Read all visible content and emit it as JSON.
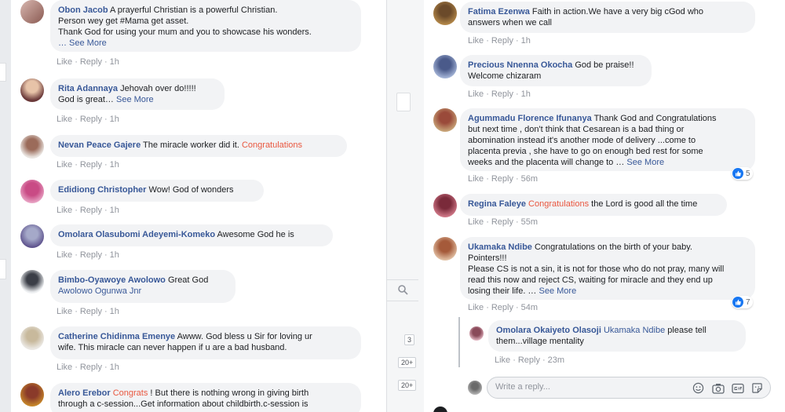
{
  "left_comments": [
    {
      "name": "Obon Jacob",
      "lines": [
        "A prayerful Christian is a powerful Christian.",
        "Person wey get #Mama get asset.",
        "Thank God for using your mum and you to showcase his wonders.",
        "… See More"
      ],
      "like": "Like",
      "reply": "Reply",
      "time": "1h"
    },
    {
      "name": "Rita Adannaya",
      "lines": [
        "Jehovah over do!!!!!",
        "God is great…"
      ],
      "see_more": "See More",
      "like": "Like",
      "reply": "Reply",
      "time": "1h"
    },
    {
      "name": "Nevan Peace Gajere",
      "text": "The miracle worker did it.",
      "highlight": "Congratulations",
      "like": "Like",
      "reply": "Reply",
      "time": "1h"
    },
    {
      "name": "Edidiong Christopher",
      "text": "Wow! God of wonders",
      "like": "Like",
      "reply": "Reply",
      "time": "1h"
    },
    {
      "name": "Omolara Olasubomi Adeyemi-Komeko",
      "text": "Awesome God he is",
      "like": "Like",
      "reply": "Reply",
      "time": "1h"
    },
    {
      "name": "Bimbo-Oyawoye Awolowo",
      "text": "Great God",
      "line2": "Awolowo Ogunwa Jnr",
      "like": "Like",
      "reply": "Reply",
      "time": "1h"
    },
    {
      "name": "Catherine Chidinma Emenye",
      "text": "Awww. God bless u Sir for loving ur",
      "line2": "wife. This miracle can never happen if u are a bad husband.",
      "like": "Like",
      "reply": "Reply",
      "time": "1h"
    },
    {
      "name": "Alero Erebor",
      "highlight": "Congrats",
      "text": "! But there is nothing wrong in giving birth",
      "line2": "through a c-session...Get information about childbirth.c-session is"
    }
  ],
  "right_comments": [
    {
      "name": "Fatima Ezenwa",
      "text": "Faith in action.We have a very big cGod who",
      "line2": "answers when we call",
      "like": "Like",
      "reply": "Reply",
      "time": "1h"
    },
    {
      "name": "Precious Nnenna Okocha",
      "text": "God be praise!!",
      "line2": "Welcome chizaram",
      "like": "Like",
      "reply": "Reply",
      "time": "1h"
    },
    {
      "name": "Agummadu Florence Ifunanya",
      "text": "Thank God and Congratulations",
      "lines": [
        "but next time , don't think that Cesarean is a bad thing or",
        "abomination instead it's another mode of delivery ...come to",
        "placenta previa , she have to go on enough bed rest for some",
        "weeks and the placenta will change to …"
      ],
      "see_more": "See More",
      "reactions": "5",
      "like": "Like",
      "reply": "Reply",
      "time": "56m"
    },
    {
      "name": "Regina Faleye",
      "highlight": "Congratulations",
      "text": "the Lord is good all the time",
      "like": "Like",
      "reply": "Reply",
      "time": "55m"
    },
    {
      "name": "Ukamaka Ndibe",
      "text": "Congratulations on the birth of your baby.",
      "lines": [
        "Pointers!!!",
        "Please CS is not a sin, it is not for those who do not pray, many will",
        "read this now and reject CS, waiting for miracle and they end up",
        "losing their life. …"
      ],
      "see_more": "See More",
      "reactions": "7",
      "like": "Like",
      "reply": "Reply",
      "time": "54m"
    }
  ],
  "nested_reply": {
    "name": "Omolara Okaiyeto Olasoji",
    "mention": "Ukamaka Ndibe",
    "text": "please tell",
    "line2": "them...village mentality",
    "like": "Like",
    "reply": "Reply",
    "time": "23m"
  },
  "reply_box": {
    "placeholder": "Write a reply..."
  },
  "strip": {
    "badge1": "3",
    "badge2": "20+",
    "badge3": "20+"
  },
  "colors": {
    "name": "#385898",
    "highlight": "#e9573f",
    "bubble": "#f2f3f5",
    "meta": "#90949c"
  },
  "icons": [
    "search-icon",
    "like-reaction-icon",
    "emoji-icon",
    "camera-icon",
    "gif-icon",
    "sticker-icon"
  ]
}
